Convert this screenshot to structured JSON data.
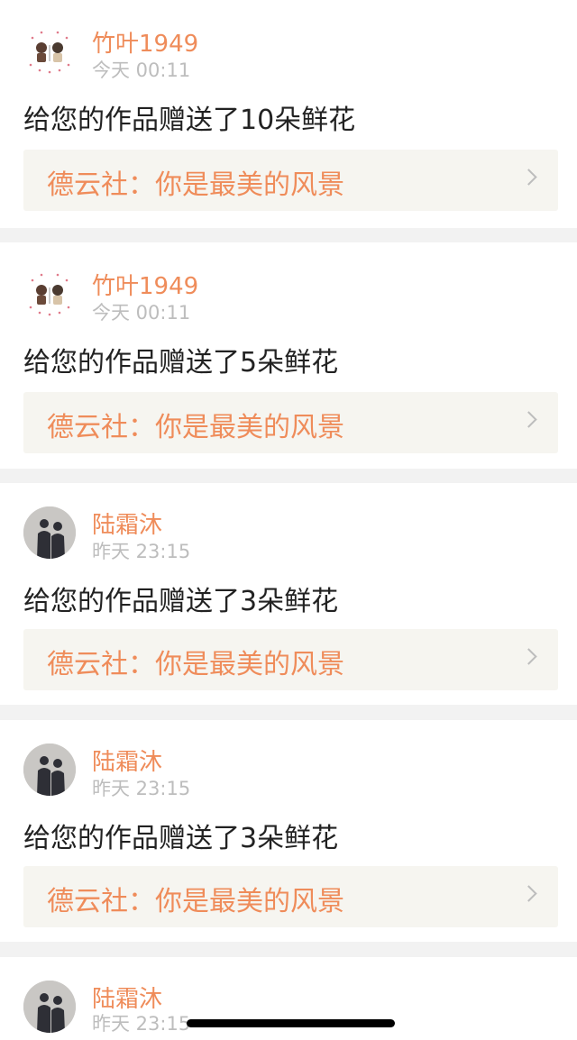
{
  "notifications": [
    {
      "user": "竹叶1949",
      "time": "今天 00:11",
      "message": "给您的作品赠送了10朵鲜花",
      "work": "德云社：你是最美的风景",
      "avatar_icon": "couple-cartoon-avatar-icon"
    },
    {
      "user": "竹叶1949",
      "time": "今天 00:11",
      "message": "给您的作品赠送了5朵鲜花",
      "work": "德云社：你是最美的风景",
      "avatar_icon": "couple-cartoon-avatar-icon"
    },
    {
      "user": "陆霜沐",
      "time": "昨天 23:15",
      "message": "给您的作品赠送了3朵鲜花",
      "work": "德云社：你是最美的风景",
      "avatar_icon": "couple-shadow-avatar-icon"
    },
    {
      "user": "陆霜沐",
      "time": "昨天 23:15",
      "message": "给您的作品赠送了3朵鲜花",
      "work": "德云社：你是最美的风景",
      "avatar_icon": "couple-shadow-avatar-icon"
    },
    {
      "user": "陆霜沐",
      "time": "昨天 23:15",
      "message": "",
      "work": "",
      "avatar_icon": "couple-shadow-avatar-icon"
    }
  ],
  "colors": {
    "accent": "#ef8c5a",
    "timestamp": "#bdbdbd",
    "link_background": "#f6f5f0",
    "separator": "#f2f2f2"
  }
}
